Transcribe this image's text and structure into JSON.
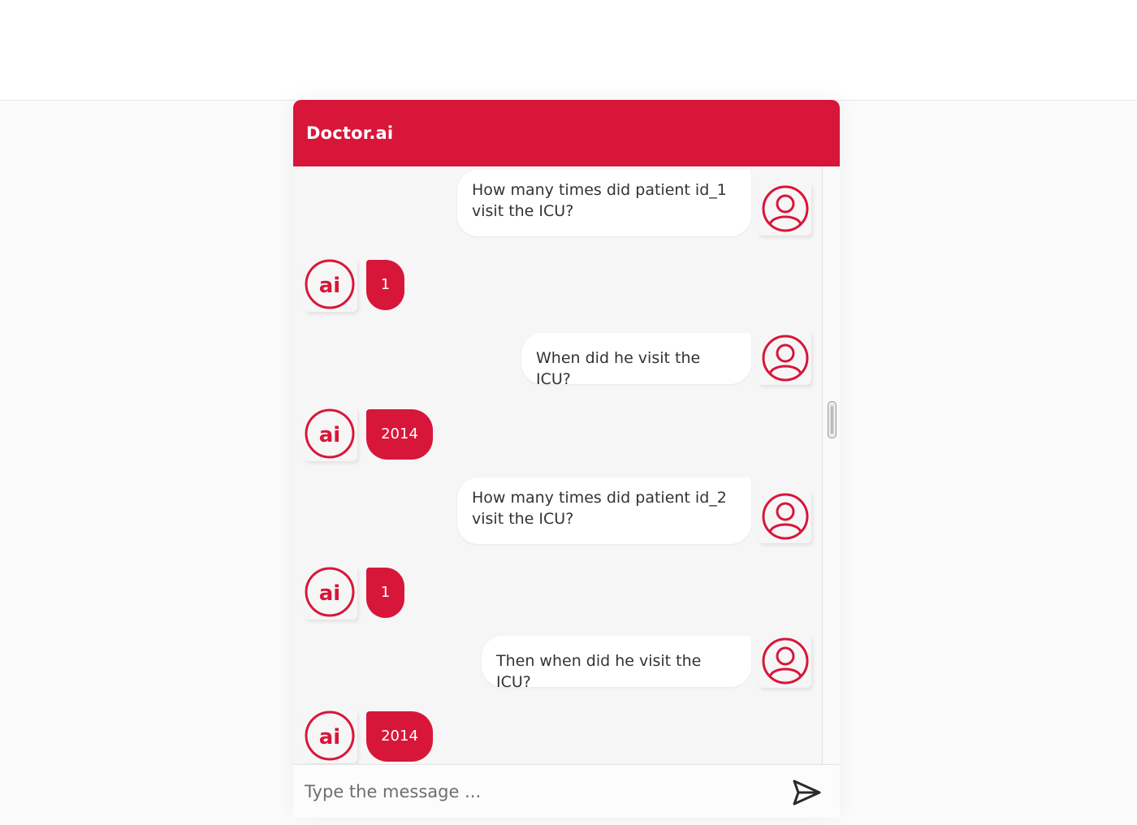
{
  "header": {
    "title": "Doctor.ai"
  },
  "messages": [
    {
      "role": "user",
      "text": "How many times did patient id_1 visit the ICU?"
    },
    {
      "role": "bot",
      "text": "1"
    },
    {
      "role": "user",
      "text": "When did he visit the ICU?"
    },
    {
      "role": "bot",
      "text": "2014"
    },
    {
      "role": "user",
      "text": "How many times did patient id_2 visit the ICU?"
    },
    {
      "role": "bot",
      "text": "1"
    },
    {
      "role": "user",
      "text": "Then when did he visit the ICU?"
    },
    {
      "role": "bot",
      "text": "2014"
    }
  ],
  "composer": {
    "placeholder": "Type the message ...",
    "value": ""
  },
  "icons": {
    "user_avatar": "user-circle-icon",
    "bot_avatar": "ai-badge-icon",
    "send": "send-icon"
  },
  "colors": {
    "brand": "#d8163a",
    "user_bubble": "#ffffff",
    "bot_bubble": "#d8163a"
  }
}
